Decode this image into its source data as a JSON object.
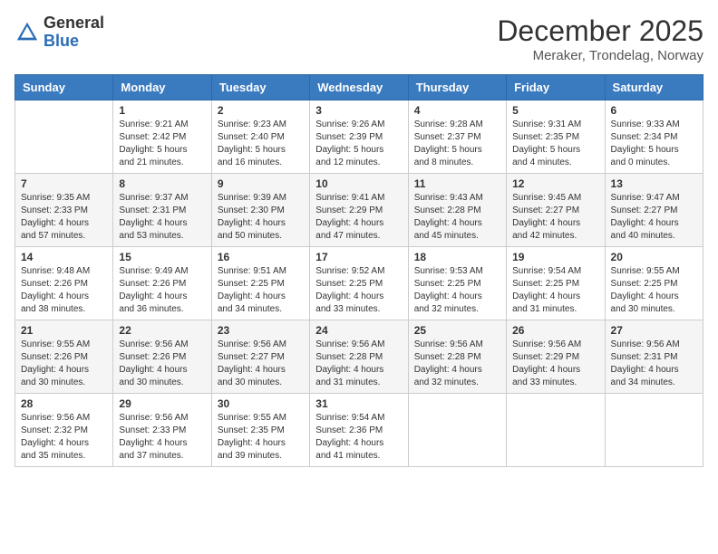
{
  "header": {
    "logo_general": "General",
    "logo_blue": "Blue",
    "month_title": "December 2025",
    "location": "Meraker, Trondelag, Norway"
  },
  "weekdays": [
    "Sunday",
    "Monday",
    "Tuesday",
    "Wednesday",
    "Thursday",
    "Friday",
    "Saturday"
  ],
  "weeks": [
    [
      {
        "day": "",
        "info": ""
      },
      {
        "day": "1",
        "info": "Sunrise: 9:21 AM\nSunset: 2:42 PM\nDaylight: 5 hours\nand 21 minutes."
      },
      {
        "day": "2",
        "info": "Sunrise: 9:23 AM\nSunset: 2:40 PM\nDaylight: 5 hours\nand 16 minutes."
      },
      {
        "day": "3",
        "info": "Sunrise: 9:26 AM\nSunset: 2:39 PM\nDaylight: 5 hours\nand 12 minutes."
      },
      {
        "day": "4",
        "info": "Sunrise: 9:28 AM\nSunset: 2:37 PM\nDaylight: 5 hours\nand 8 minutes."
      },
      {
        "day": "5",
        "info": "Sunrise: 9:31 AM\nSunset: 2:35 PM\nDaylight: 5 hours\nand 4 minutes."
      },
      {
        "day": "6",
        "info": "Sunrise: 9:33 AM\nSunset: 2:34 PM\nDaylight: 5 hours\nand 0 minutes."
      }
    ],
    [
      {
        "day": "7",
        "info": "Sunrise: 9:35 AM\nSunset: 2:33 PM\nDaylight: 4 hours\nand 57 minutes."
      },
      {
        "day": "8",
        "info": "Sunrise: 9:37 AM\nSunset: 2:31 PM\nDaylight: 4 hours\nand 53 minutes."
      },
      {
        "day": "9",
        "info": "Sunrise: 9:39 AM\nSunset: 2:30 PM\nDaylight: 4 hours\nand 50 minutes."
      },
      {
        "day": "10",
        "info": "Sunrise: 9:41 AM\nSunset: 2:29 PM\nDaylight: 4 hours\nand 47 minutes."
      },
      {
        "day": "11",
        "info": "Sunrise: 9:43 AM\nSunset: 2:28 PM\nDaylight: 4 hours\nand 45 minutes."
      },
      {
        "day": "12",
        "info": "Sunrise: 9:45 AM\nSunset: 2:27 PM\nDaylight: 4 hours\nand 42 minutes."
      },
      {
        "day": "13",
        "info": "Sunrise: 9:47 AM\nSunset: 2:27 PM\nDaylight: 4 hours\nand 40 minutes."
      }
    ],
    [
      {
        "day": "14",
        "info": "Sunrise: 9:48 AM\nSunset: 2:26 PM\nDaylight: 4 hours\nand 38 minutes."
      },
      {
        "day": "15",
        "info": "Sunrise: 9:49 AM\nSunset: 2:26 PM\nDaylight: 4 hours\nand 36 minutes."
      },
      {
        "day": "16",
        "info": "Sunrise: 9:51 AM\nSunset: 2:25 PM\nDaylight: 4 hours\nand 34 minutes."
      },
      {
        "day": "17",
        "info": "Sunrise: 9:52 AM\nSunset: 2:25 PM\nDaylight: 4 hours\nand 33 minutes."
      },
      {
        "day": "18",
        "info": "Sunrise: 9:53 AM\nSunset: 2:25 PM\nDaylight: 4 hours\nand 32 minutes."
      },
      {
        "day": "19",
        "info": "Sunrise: 9:54 AM\nSunset: 2:25 PM\nDaylight: 4 hours\nand 31 minutes."
      },
      {
        "day": "20",
        "info": "Sunrise: 9:55 AM\nSunset: 2:25 PM\nDaylight: 4 hours\nand 30 minutes."
      }
    ],
    [
      {
        "day": "21",
        "info": "Sunrise: 9:55 AM\nSunset: 2:26 PM\nDaylight: 4 hours\nand 30 minutes."
      },
      {
        "day": "22",
        "info": "Sunrise: 9:56 AM\nSunset: 2:26 PM\nDaylight: 4 hours\nand 30 minutes."
      },
      {
        "day": "23",
        "info": "Sunrise: 9:56 AM\nSunset: 2:27 PM\nDaylight: 4 hours\nand 30 minutes."
      },
      {
        "day": "24",
        "info": "Sunrise: 9:56 AM\nSunset: 2:28 PM\nDaylight: 4 hours\nand 31 minutes."
      },
      {
        "day": "25",
        "info": "Sunrise: 9:56 AM\nSunset: 2:28 PM\nDaylight: 4 hours\nand 32 minutes."
      },
      {
        "day": "26",
        "info": "Sunrise: 9:56 AM\nSunset: 2:29 PM\nDaylight: 4 hours\nand 33 minutes."
      },
      {
        "day": "27",
        "info": "Sunrise: 9:56 AM\nSunset: 2:31 PM\nDaylight: 4 hours\nand 34 minutes."
      }
    ],
    [
      {
        "day": "28",
        "info": "Sunrise: 9:56 AM\nSunset: 2:32 PM\nDaylight: 4 hours\nand 35 minutes."
      },
      {
        "day": "29",
        "info": "Sunrise: 9:56 AM\nSunset: 2:33 PM\nDaylight: 4 hours\nand 37 minutes."
      },
      {
        "day": "30",
        "info": "Sunrise: 9:55 AM\nSunset: 2:35 PM\nDaylight: 4 hours\nand 39 minutes."
      },
      {
        "day": "31",
        "info": "Sunrise: 9:54 AM\nSunset: 2:36 PM\nDaylight: 4 hours\nand 41 minutes."
      },
      {
        "day": "",
        "info": ""
      },
      {
        "day": "",
        "info": ""
      },
      {
        "day": "",
        "info": ""
      }
    ]
  ]
}
